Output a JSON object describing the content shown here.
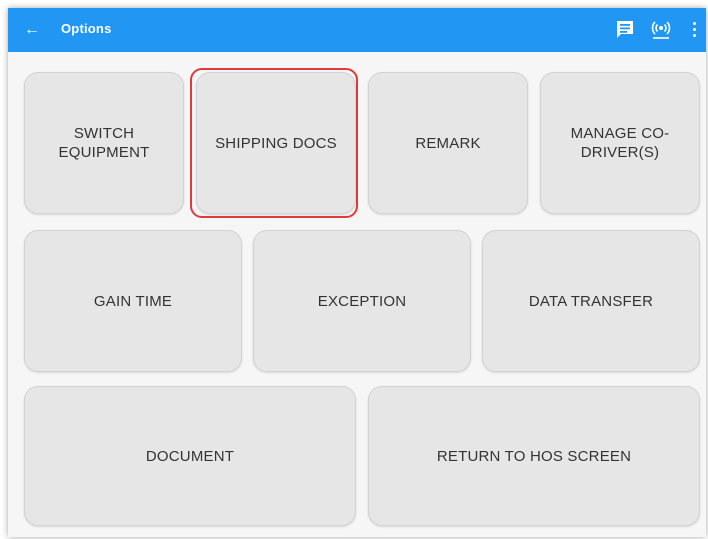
{
  "topbar": {
    "back_icon": "arrow-left-icon",
    "title": "Options",
    "message_icon": "message-icon",
    "radio_icon": "broadcast-icon",
    "menu_icon": "more-vert-icon",
    "color": "#2196f3"
  },
  "tiles": {
    "switch_equipment": "SWITCH\nEQUIPMENT",
    "shipping_docs": "SHIPPING DOCS",
    "remark": "REMARK",
    "manage_codriver": "MANAGE CO-\nDRIVER(S)",
    "gain_time": "GAIN TIME",
    "exception": "EXCEPTION",
    "data_transfer": "DATA TRANSFER",
    "document": "DOCUMENT",
    "return_hos": "RETURN TO HOS SCREEN"
  },
  "highlight_color": "#e03a3a"
}
